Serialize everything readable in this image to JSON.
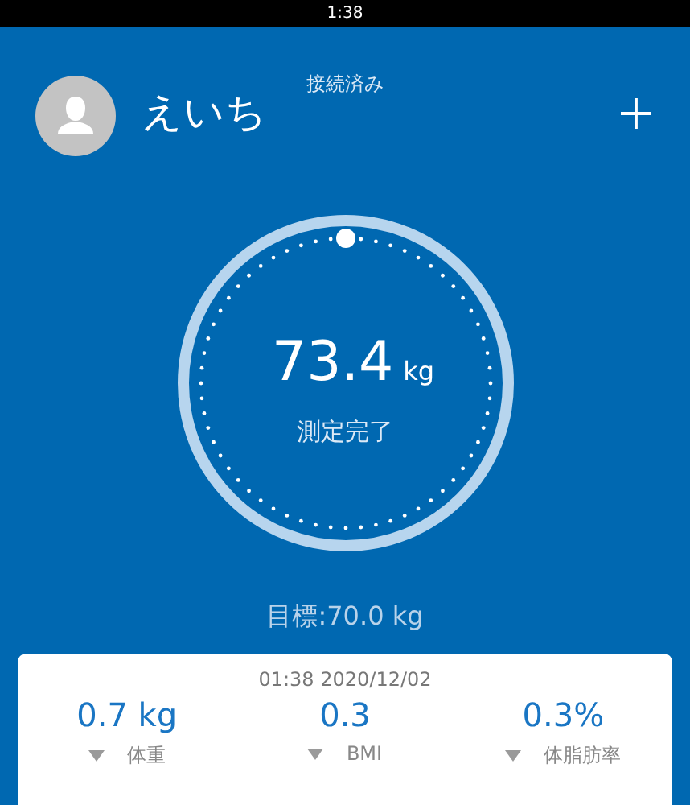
{
  "status_bar": {
    "time": "1:38"
  },
  "header": {
    "connection": "接続済み",
    "user_name": "えいち"
  },
  "measurement": {
    "value": "73.4",
    "unit": "kg",
    "status": "測定完了"
  },
  "goal": "目標:70.0 kg",
  "summary": {
    "timestamp": "01:38 2020/12/02",
    "metrics": [
      {
        "value": "0.7 kg",
        "label": "体重",
        "decreased": true
      },
      {
        "value": "0.3",
        "label": "BMI",
        "decreased": true
      },
      {
        "value": "0.3%",
        "label": "体脂肪率",
        "decreased": true
      }
    ]
  }
}
